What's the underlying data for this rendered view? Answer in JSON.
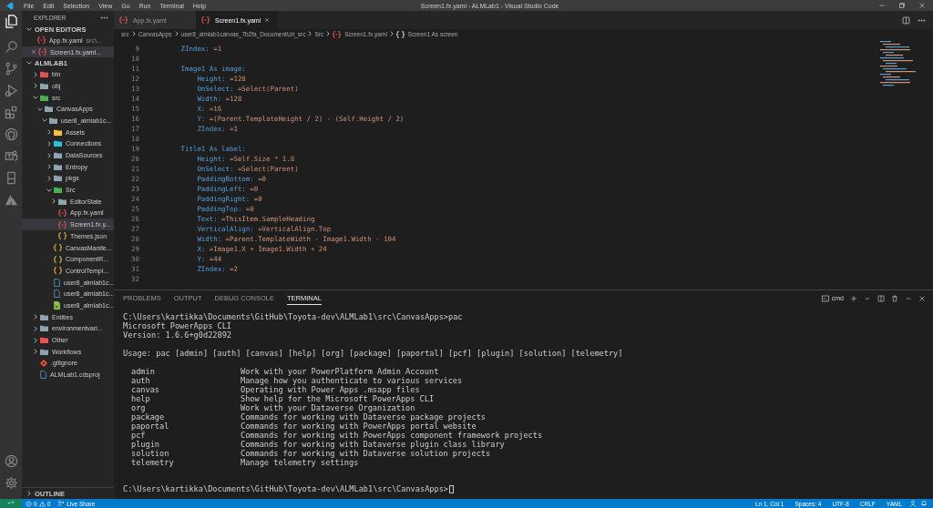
{
  "window": {
    "title": "Screen1.fx.yaml - ALMLab1 - Visual Studio Code"
  },
  "menu": [
    "File",
    "Edit",
    "Selection",
    "View",
    "Go",
    "Run",
    "Terminal",
    "Help"
  ],
  "sidebar": {
    "title": "EXPLORER",
    "open_editors": {
      "label": "OPEN EDITORS",
      "expanded": true,
      "items": [
        {
          "name": "App.fx.yaml",
          "description": "src\\...",
          "selected": false
        },
        {
          "name": "Screen1.fx.yaml...",
          "selected": true
        }
      ]
    },
    "folder": {
      "label": "ALMLAB1",
      "expanded": true,
      "items": [
        {
          "name": "bin",
          "kind": "folder",
          "color": "#e05252",
          "expanded": false,
          "selected": false
        },
        {
          "name": "obj",
          "kind": "folder",
          "color": "#90a4ae",
          "expanded": false,
          "selected": false
        },
        {
          "name": "src",
          "kind": "folder",
          "color": "#4caf50",
          "expanded": true,
          "selected": false,
          "children": [
            {
              "name": "CanvasApps",
              "kind": "folder",
              "color": "#90a4ae",
              "expanded": true,
              "selected": false,
              "children": [
                {
                  "name": "user8_almlab1c...",
                  "kind": "folder",
                  "color": "#90a4ae",
                  "expanded": true,
                  "selected": false,
                  "children": [
                    {
                      "name": "Assets",
                      "kind": "folder",
                      "color": "#f9c23c",
                      "expanded": false,
                      "selected": false
                    },
                    {
                      "name": "Connections",
                      "kind": "folder",
                      "color": "#26c6da",
                      "expanded": false,
                      "selected": false
                    },
                    {
                      "name": "DataSources",
                      "kind": "folder",
                      "color": "#90a4ae",
                      "expanded": false,
                      "selected": false
                    },
                    {
                      "name": "Entropy",
                      "kind": "folder",
                      "color": "#90a4ae",
                      "expanded": false,
                      "selected": false
                    },
                    {
                      "name": "pkgs",
                      "kind": "folder",
                      "color": "#90a4ae",
                      "expanded": false,
                      "selected": false
                    },
                    {
                      "name": "Src",
                      "kind": "folder",
                      "color": "#4caf50",
                      "expanded": true,
                      "selected": false,
                      "children": [
                        {
                          "name": "EditorState",
                          "kind": "folder",
                          "color": "#90a4ae",
                          "expanded": false,
                          "selected": false
                        },
                        {
                          "name": "App.fx.yaml",
                          "kind": "yaml",
                          "selected": false
                        },
                        {
                          "name": "Screen1.fx.y...",
                          "kind": "yaml",
                          "selected": true
                        },
                        {
                          "name": "Themes.json",
                          "kind": "json",
                          "selected": false
                        }
                      ]
                    },
                    {
                      "name": "CanvasManife...",
                      "kind": "json",
                      "selected": false
                    },
                    {
                      "name": "ComponentR...",
                      "kind": "json",
                      "selected": false
                    },
                    {
                      "name": "ControlTempl...",
                      "kind": "json",
                      "selected": false
                    },
                    {
                      "name": "user8_almlab1c...",
                      "kind": "file",
                      "selected": false
                    },
                    {
                      "name": "user8_almlab1c...",
                      "kind": "file",
                      "selected": false
                    },
                    {
                      "name": "user8_almlab1c...",
                      "kind": "sheet",
                      "selected": false
                    }
                  ]
                }
              ]
            }
          ]
        },
        {
          "name": "Entities",
          "kind": "folder",
          "color": "#90a4ae",
          "expanded": false,
          "selected": false
        },
        {
          "name": "environmentvari...",
          "kind": "folder",
          "color": "#90a4ae",
          "expanded": false,
          "selected": false
        },
        {
          "name": "Other",
          "kind": "folder",
          "color": "#ef5350",
          "expanded": false,
          "selected": false
        },
        {
          "name": "Workflows",
          "kind": "folder",
          "color": "#90a4ae",
          "expanded": false,
          "selected": false
        },
        {
          "name": ".gitignore",
          "kind": "git",
          "selected": false
        },
        {
          "name": "ALMLab1.cdsproj",
          "kind": "file",
          "selected": false
        }
      ]
    },
    "outline": {
      "label": "OUTLINE",
      "expanded": false
    }
  },
  "tabs": [
    {
      "label": "App.fx.yaml",
      "selected": false
    },
    {
      "label": "Screen1.fx.yaml",
      "selected": true
    }
  ],
  "breadcrumb": [
    {
      "label": "src",
      "kind": "folder"
    },
    {
      "label": "CanvasApps",
      "kind": "folder"
    },
    {
      "label": "user8_almlab1canvas_7b2fa_DocumentUri_src",
      "kind": "folder"
    },
    {
      "label": "Src",
      "kind": "folder"
    },
    {
      "label": "Screen1.fx.yaml",
      "kind": "yaml"
    },
    {
      "label": "Screen1 As screen",
      "kind": "object"
    }
  ],
  "code": [
    {
      "number": "9",
      "kind": "outer",
      "key": "ZIndex:",
      "value": "=1"
    },
    {
      "number": "10",
      "kind": "blank"
    },
    {
      "number": "11",
      "kind": "block",
      "key": "Image1 As image:"
    },
    {
      "number": "12",
      "kind": "prop",
      "key": "Height:",
      "value": "=128"
    },
    {
      "number": "13",
      "kind": "prop",
      "key": "OnSelect:",
      "value": "=Select(Parent)"
    },
    {
      "number": "14",
      "kind": "prop",
      "key": "Width:",
      "value": "=128"
    },
    {
      "number": "15",
      "kind": "prop",
      "key": "X:",
      "value": "=16"
    },
    {
      "number": "16",
      "kind": "prop",
      "key": "Y:",
      "value": "=(Parent.TemplateHeight / 2) - (Self.Height / 2)"
    },
    {
      "number": "17",
      "kind": "prop",
      "key": "ZIndex:",
      "value": "=1"
    },
    {
      "number": "18",
      "kind": "blank"
    },
    {
      "number": "19",
      "kind": "block",
      "key": "Title1 As label:"
    },
    {
      "number": "20",
      "kind": "prop",
      "key": "Height:",
      "value": "=Self.Size * 1.8"
    },
    {
      "number": "21",
      "kind": "prop",
      "key": "OnSelect:",
      "value": "=Select(Parent)"
    },
    {
      "number": "22",
      "kind": "prop",
      "key": "PaddingBottom:",
      "value": "=0"
    },
    {
      "number": "23",
      "kind": "prop",
      "key": "PaddingLeft:",
      "value": "=0"
    },
    {
      "number": "24",
      "kind": "prop",
      "key": "PaddingRight:",
      "value": "=0"
    },
    {
      "number": "25",
      "kind": "prop",
      "key": "PaddingTop:",
      "value": "=0"
    },
    {
      "number": "26",
      "kind": "prop",
      "key": "Text:",
      "value": "=ThisItem.SampleHeading"
    },
    {
      "number": "27",
      "kind": "prop",
      "key": "VerticalAlign:",
      "value": "=VerticalAlign.Top"
    },
    {
      "number": "28",
      "kind": "prop",
      "key": "Width:",
      "value": "=Parent.TemplateWidth - Image1.Width - 104"
    },
    {
      "number": "29",
      "kind": "prop",
      "key": "X:",
      "value": "=Image1.X + Image1.Width + 24"
    },
    {
      "number": "30",
      "kind": "prop",
      "key": "Y:",
      "value": "=44"
    },
    {
      "number": "31",
      "kind": "prop",
      "key": "ZIndex:",
      "value": "=2"
    },
    {
      "number": "32",
      "kind": "blank"
    }
  ],
  "panel": {
    "tabs": [
      {
        "label": "PROBLEMS",
        "selected": false
      },
      {
        "label": "OUTPUT",
        "selected": false
      },
      {
        "label": "DEBUG CONSOLE",
        "selected": false
      },
      {
        "label": "TERMINAL",
        "selected": true
      }
    ],
    "shell": "cmd",
    "terminal": {
      "lines": [
        "C:\\Users\\kartikka\\Documents\\GitHub\\Toyota-dev\\ALMLab1\\src\\CanvasApps>pac",
        "Microsoft PowerApps CLI",
        "Version: 1.6.6+g0d22892"
      ],
      "usage": "Usage: pac [admin] [auth] [canvas] [help] [org] [package] [paportal] [pcf] [plugin] [solution] [telemetry]",
      "commands": [
        {
          "name": "admin",
          "description": "Work with your PowerPlatform Admin Account"
        },
        {
          "name": "auth",
          "description": "Manage how you authenticate to various services"
        },
        {
          "name": "canvas",
          "description": "Operating with Power Apps .msapp files"
        },
        {
          "name": "help",
          "description": "Show help for the Microsoft PowerApps CLI"
        },
        {
          "name": "org",
          "description": "Work with your Dataverse Organization"
        },
        {
          "name": "package",
          "description": "Commands for working with Dataverse package projects"
        },
        {
          "name": "paportal",
          "description": "Commands for working with PowerApps portal website"
        },
        {
          "name": "pcf",
          "description": "Commands for working with PowerApps component framework projects"
        },
        {
          "name": "plugin",
          "description": "Commands for working with Dataverse plugin class library"
        },
        {
          "name": "solution",
          "description": "Commands for working with Dataverse solution projects"
        },
        {
          "name": "telemetry",
          "description": "Manage telemetry settings"
        }
      ],
      "prompt": "C:\\Users\\kartikka\\Documents\\GitHub\\Toyota-dev\\ALMLab1\\src\\CanvasApps>"
    }
  },
  "status_bar": {
    "errors": "0",
    "warnings": "0",
    "live_share": "Live Share",
    "right": [
      "Ln 1, Col 1",
      "Spaces: 4",
      "UTF-8",
      "CRLF",
      "YAML"
    ]
  }
}
